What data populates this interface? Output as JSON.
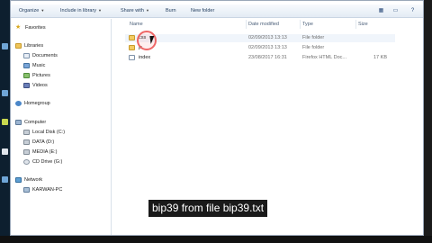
{
  "toolbar": {
    "organize": "Organize",
    "include_in_library": "Include in library",
    "share_with": "Share with",
    "burn": "Burn",
    "new_folder": "New folder",
    "icons": [
      "view-options-icon",
      "preview-pane-icon",
      "help-icon"
    ]
  },
  "nav": {
    "favorites": "Favorites",
    "libraries": "Libraries",
    "library_items": [
      "Documents",
      "Music",
      "Pictures",
      "Videos"
    ],
    "homegroup": "Homegroup",
    "computer": "Computer",
    "drives": [
      "Local Disk (C:)",
      "DATA (D:)",
      "MEDIA (E:)",
      "CD Drive (G:)"
    ],
    "network": "Network",
    "network_items": [
      "KARWAN-PC"
    ]
  },
  "columns": {
    "name": "Name",
    "date_modified": "Date modified",
    "type": "Type",
    "size": "Size"
  },
  "files": [
    {
      "name": "css",
      "date": "02/09/2013 13:13",
      "type": "File folder",
      "size": ""
    },
    {
      "name": "js",
      "date": "02/09/2013 13:13",
      "type": "File folder",
      "size": ""
    },
    {
      "name": "index",
      "date": "23/08/2017 16:31",
      "type": "Firefox HTML Doc...",
      "size": "17 KB"
    }
  ],
  "caption": "bip39 from file bip39.txt"
}
